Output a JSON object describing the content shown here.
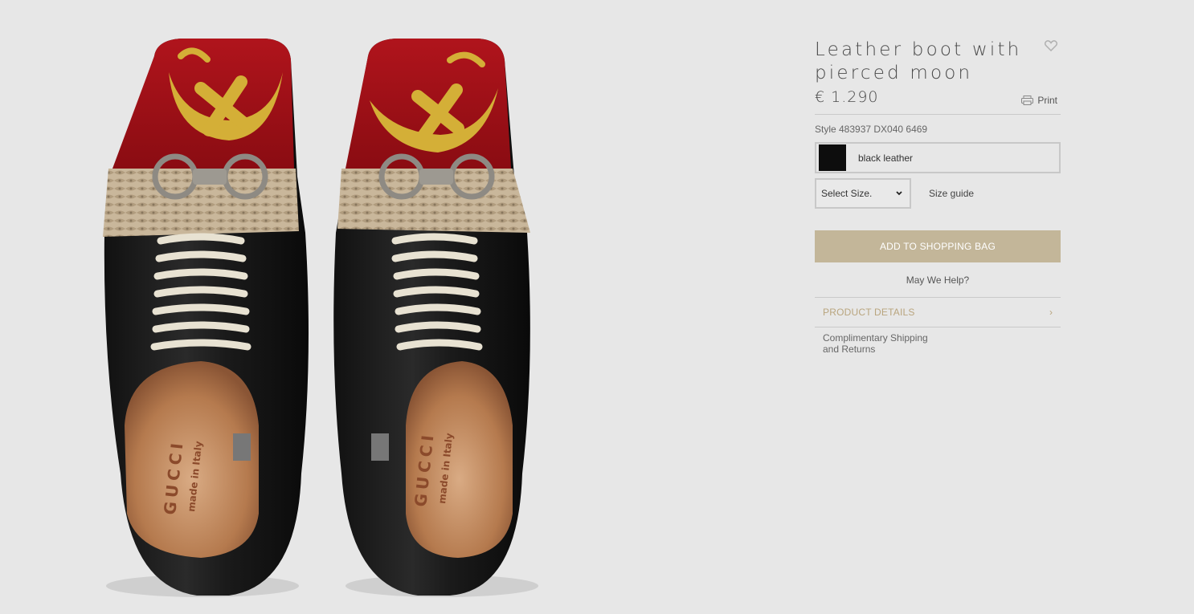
{
  "product": {
    "title": "Leather boot with pierced moon",
    "price": "€ 1.290",
    "style": "Style 483937 DX040 6469",
    "color": {
      "label": "black leather",
      "swatch": "#0d0d0d"
    },
    "size_select": "Select Size.",
    "size_guide": "Size guide",
    "add_to_bag": "ADD TO SHOPPING BAG",
    "help": "May We Help?",
    "details_label": "PRODUCT DETAILS",
    "shipping": "Complimentary Shipping and Returns"
  },
  "actions": {
    "print_label": "Print"
  },
  "image": {
    "insole_brand": "GUCCI",
    "insole_text": "made in Italy"
  },
  "icons": {
    "wishlist": "heart-outline-icon",
    "print": "printer-icon",
    "select": "chevron-down-icon",
    "details": "chevron-right-icon"
  },
  "colors": {
    "accent": "#c3b699",
    "background": "#e7e7e7",
    "details_text": "#b9a57e"
  }
}
